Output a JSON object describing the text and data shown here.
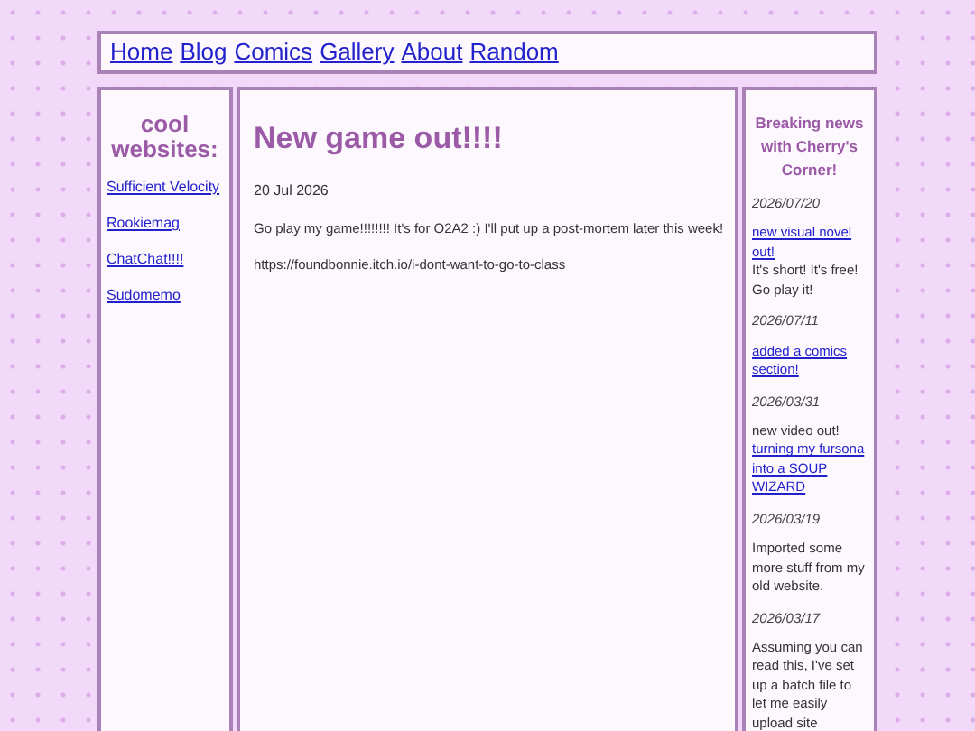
{
  "nav": [
    "Home",
    "Blog",
    "Comics",
    "Gallery",
    "About",
    "Random"
  ],
  "sidebar": {
    "title": "cool websites:",
    "links": [
      "Sufficient Velocity",
      "Rookiemag",
      "ChatChat!!!!",
      "Sudomemo"
    ]
  },
  "post": {
    "title": "New game out!!!!",
    "date": "20 Jul 2026",
    "paragraphs": [
      "Go play my game!!!!!!!! It's for O2A2 :) I'll put up a post-mortem later this week!",
      "https://foundbonnie.itch.io/i-dont-want-to-go-to-class"
    ]
  },
  "news": {
    "title": "Breaking news with Cherry's Corner!",
    "entries": [
      {
        "date": "2026/07/20",
        "parts": [
          {
            "kind": "link",
            "text": "new visual novel out!"
          },
          {
            "kind": "text",
            "text": "It's short! It's free! Go play it!"
          }
        ]
      },
      {
        "date": "2026/07/11",
        "parts": [
          {
            "kind": "link",
            "text": "added a comics section!"
          }
        ]
      },
      {
        "date": "2026/03/31",
        "parts": [
          {
            "kind": "text",
            "text": "new video out!"
          },
          {
            "kind": "link",
            "text": "turning my fursona into a SOUP WIZARD"
          }
        ]
      },
      {
        "date": "2026/03/19",
        "parts": [
          {
            "kind": "text",
            "text": "Imported some more stuff from my old website."
          }
        ]
      },
      {
        "date": "2026/03/17",
        "parts": [
          {
            "kind": "text",
            "text": "Assuming you can read this, I've set up a batch file to let me easily upload site"
          }
        ]
      }
    ]
  }
}
